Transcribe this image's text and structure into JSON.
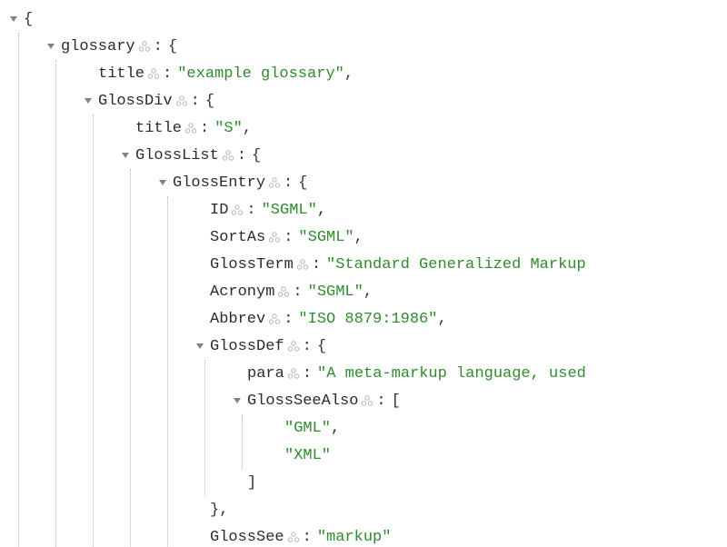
{
  "root_open": "{",
  "glossary": {
    "key": "glossary",
    "open": "{",
    "title_key": "title",
    "title_val": "\"example glossary\"",
    "GlossDiv": {
      "key": "GlossDiv",
      "open": "{",
      "title_key": "title",
      "title_val": "\"S\"",
      "GlossList": {
        "key": "GlossList",
        "open": "{",
        "GlossEntry": {
          "key": "GlossEntry",
          "open": "{",
          "ID_key": "ID",
          "ID_val": "\"SGML\"",
          "SortAs_key": "SortAs",
          "SortAs_val": "\"SGML\"",
          "GlossTerm_key": "GlossTerm",
          "GlossTerm_val": "\"Standard Generalized Markup",
          "Acronym_key": "Acronym",
          "Acronym_val": "\"SGML\"",
          "Abbrev_key": "Abbrev",
          "Abbrev_val": "\"ISO 8879:1986\"",
          "GlossDef": {
            "key": "GlossDef",
            "open": "{",
            "para_key": "para",
            "para_val": "\"A meta-markup language, used",
            "GlossSeeAlso": {
              "key": "GlossSeeAlso",
              "open": "[",
              "item0": "\"GML\"",
              "item1": "\"XML\"",
              "close": "]"
            },
            "close": "},"
          },
          "GlossSee_key": "GlossSee",
          "GlossSee_val": "\"markup\""
        }
      }
    }
  },
  "punct": {
    "colon": ":",
    "comma": ","
  }
}
